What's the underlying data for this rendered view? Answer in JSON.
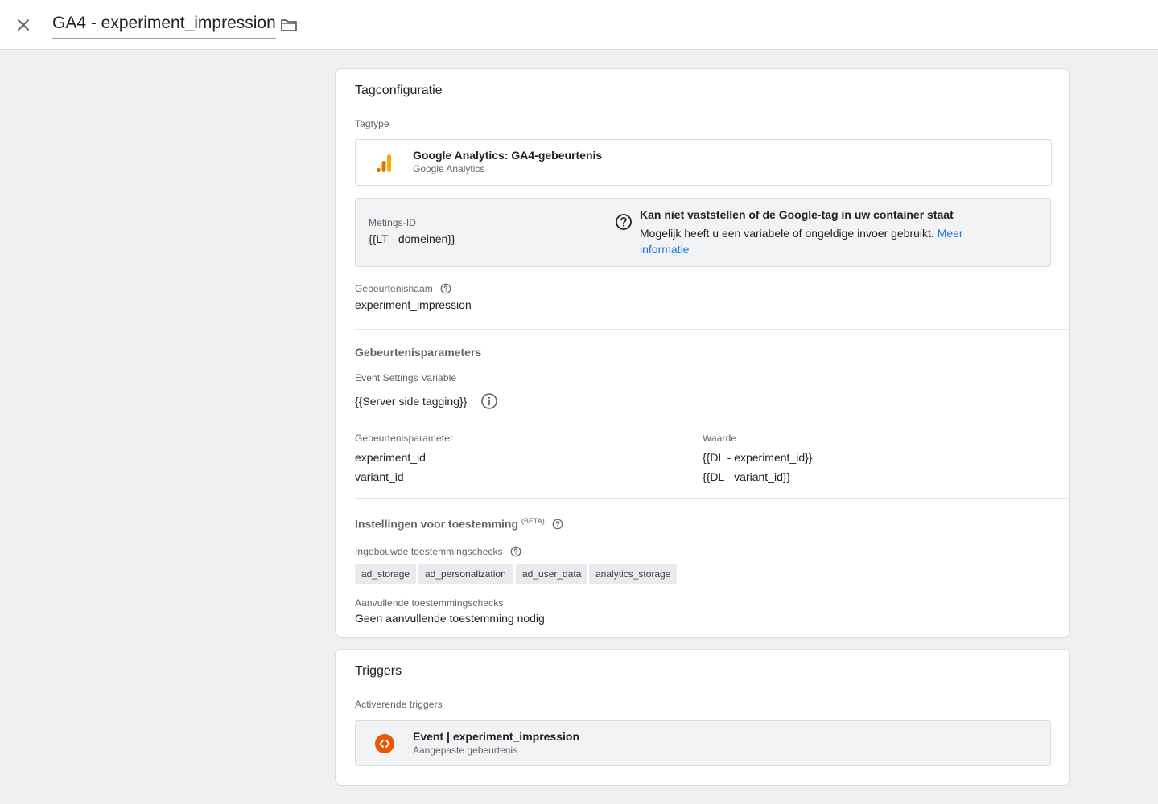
{
  "header": {
    "title": "GA4 - experiment_impression",
    "close_icon": "close-icon",
    "folder_icon": "folder-icon"
  },
  "tag_config": {
    "title": "Tagconfiguratie",
    "tagtype_label": "Tagtype",
    "tagtype": {
      "name": "Google Analytics: GA4-gebeurtenis",
      "sub": "Google Analytics",
      "icon": "google-analytics-icon"
    },
    "measurement": {
      "label": "Metings-ID",
      "value": "{{LT - domeinen}}",
      "warning_title": "Kan niet vaststellen of de Google-tag in uw container staat",
      "warning_text": "Mogelijk heeft u een variabele of ongeldige invoer gebruikt.",
      "warning_link": "Meer informatie"
    },
    "event_name": {
      "label": "Gebeurtenisnaam",
      "value": "experiment_impression"
    },
    "params": {
      "title": "Gebeurtenisparameters",
      "settings_label": "Event Settings Variable",
      "settings_value": "{{Server side tagging}}",
      "col_param": "Gebeurtenisparameter",
      "col_value": "Waarde",
      "rows": [
        {
          "param": "experiment_id",
          "value": "{{DL - experiment_id}}"
        },
        {
          "param": "variant_id",
          "value": "{{DL - variant_id}}"
        }
      ]
    },
    "consent": {
      "title": "Instellingen voor toestemming",
      "beta": "(BETA)",
      "builtin_label": "Ingebouwde toestemmingschecks",
      "chips": [
        "ad_storage",
        "ad_personalization",
        "ad_user_data",
        "analytics_storage"
      ],
      "additional_label": "Aanvullende toestemmingschecks",
      "additional_value": "Geen aanvullende toestemming nodig"
    }
  },
  "triggers": {
    "title": "Triggers",
    "label": "Activerende triggers",
    "item": {
      "name": "Event | experiment_impression",
      "sub": "Aangepaste gebeurtenis",
      "icon": "custom-event-icon"
    }
  },
  "colors": {
    "accent": "#1a73e8",
    "ga_orange": "#f9ab00",
    "ga_dark_orange": "#e37400",
    "trigger_orange": "#e8590c"
  }
}
